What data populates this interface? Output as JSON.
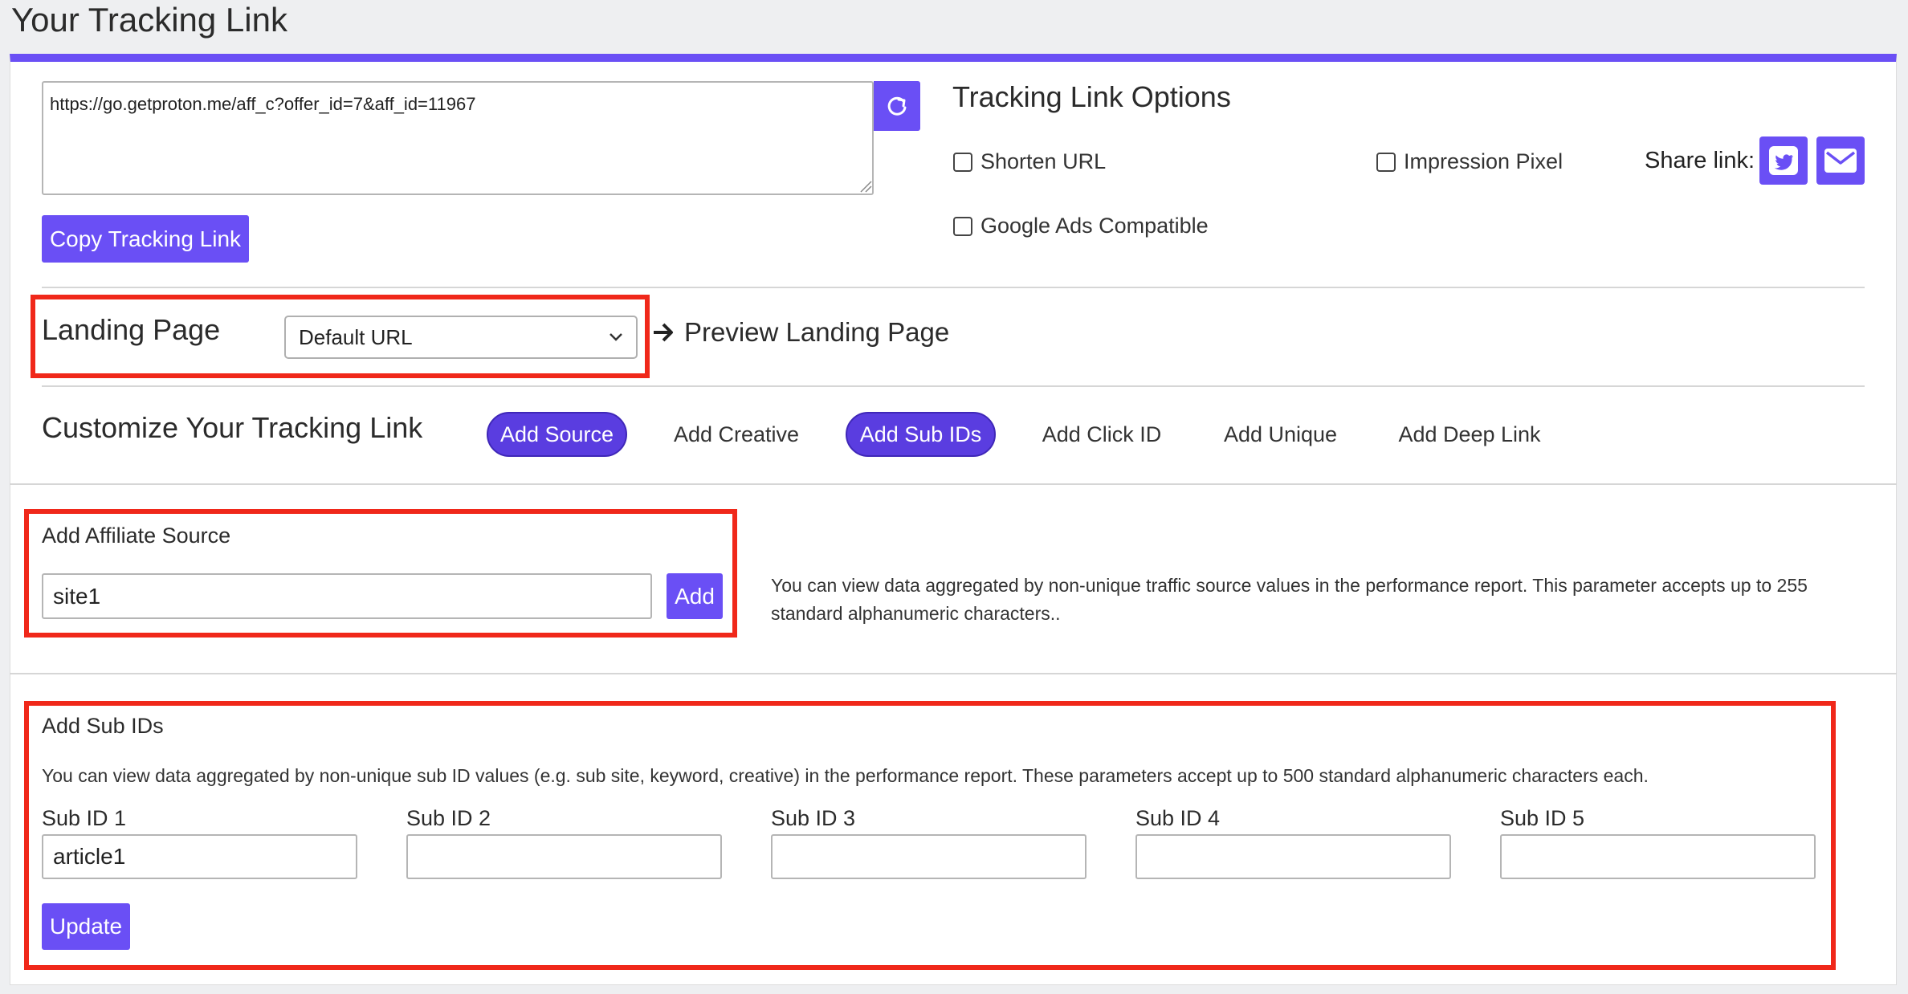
{
  "page": {
    "title": "Your Tracking Link"
  },
  "tracking_link": {
    "url": "https://go.getproton.me/aff_c?offer_id=7&aff_id=11967",
    "copy_label": "Copy Tracking Link"
  },
  "options": {
    "title": "Tracking Link Options",
    "shorten_url": "Shorten URL",
    "impression_pixel": "Impression Pixel",
    "google_ads": "Google Ads Compatible",
    "share_label": "Share link:"
  },
  "landing_page": {
    "label": "Landing Page",
    "selected": "Default URL",
    "preview_label": "Preview Landing Page"
  },
  "customize": {
    "title": "Customize Your Tracking Link",
    "tabs": [
      {
        "label": "Add Source",
        "active": true
      },
      {
        "label": "Add Creative",
        "active": false
      },
      {
        "label": "Add Sub IDs",
        "active": true
      },
      {
        "label": "Add Click ID",
        "active": false
      },
      {
        "label": "Add Unique",
        "active": false
      },
      {
        "label": "Add Deep Link",
        "active": false
      }
    ]
  },
  "affiliate_source": {
    "title": "Add Affiliate Source",
    "value": "site1",
    "add_label": "Add",
    "help_line1": "You can view data aggregated by non-unique traffic source values in the performance report. This parameter accepts up to 255",
    "help_line2": "standard alphanumeric characters.."
  },
  "sub_ids": {
    "title": "Add Sub IDs",
    "help": "You can view data aggregated by non-unique sub ID values (e.g. sub site, keyword, creative) in the performance report. These parameters accept up to 500 standard alphanumeric characters each.",
    "fields": [
      {
        "label": "Sub ID 1",
        "value": "article1"
      },
      {
        "label": "Sub ID 2",
        "value": ""
      },
      {
        "label": "Sub ID 3",
        "value": ""
      },
      {
        "label": "Sub ID 4",
        "value": ""
      },
      {
        "label": "Sub ID 5",
        "value": ""
      }
    ],
    "update_label": "Update"
  },
  "colors": {
    "accent": "#6a4ff5",
    "highlight": "#f0281a"
  }
}
